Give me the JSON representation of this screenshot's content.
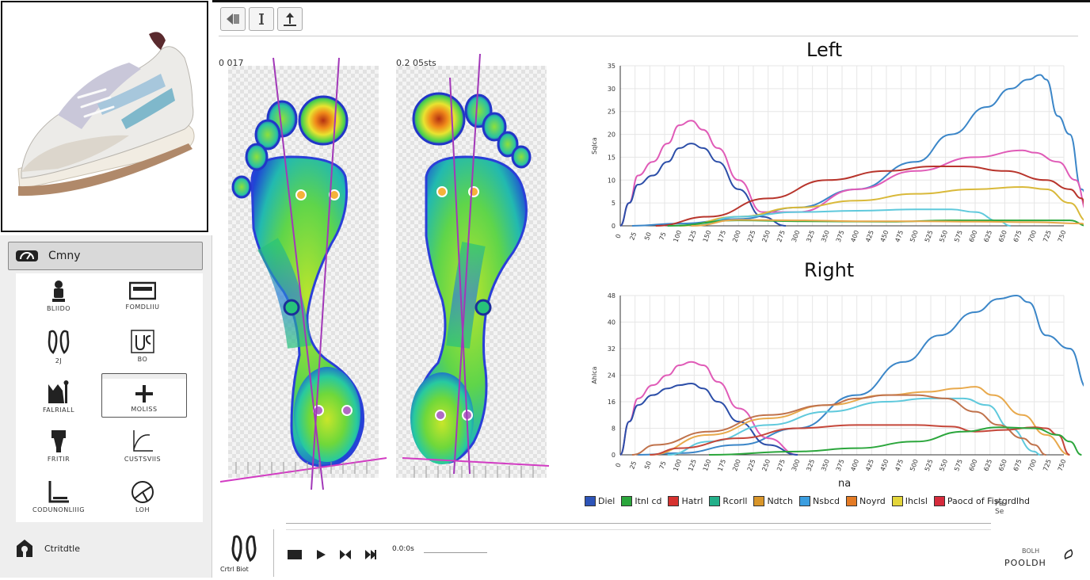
{
  "sidebar": {
    "category_label": "Cmny",
    "tools": [
      {
        "label": "BLIIDO",
        "icon": "person-icon"
      },
      {
        "label": "FOMDLIIU",
        "icon": "platform-icon"
      },
      {
        "label": "2J",
        "icon": "footprints-icon"
      },
      {
        "label": "BO",
        "icon": "foot-outline-icon"
      },
      {
        "label": "FALRIALL",
        "icon": "posture-icon"
      },
      {
        "label": "MOLISS",
        "icon": "plus-icon"
      },
      {
        "label": "FRITIR",
        "icon": "leg-icon"
      },
      {
        "label": "CUSTSVIIS",
        "icon": "curve-icon"
      },
      {
        "label": "CODUNONLIIIG",
        "icon": "angle-icon"
      },
      {
        "label": "LOH",
        "icon": "compass-icon"
      }
    ],
    "footer_label": "Ctritdtle"
  },
  "toolbar": {
    "buttons": [
      "back-icon",
      "info-icon",
      "upload-icon"
    ]
  },
  "footprints": {
    "left_label": "0 017",
    "right_label": "0.2 05sts"
  },
  "charts": {
    "left_title": "Left",
    "right_title": "Right",
    "left_ylabel": "Sqlca",
    "right_ylabel": "Ahlca",
    "xunit": "na"
  },
  "legend": [
    {
      "label": "Diel",
      "color": "#2d54b8"
    },
    {
      "label": "Itnl cd",
      "color": "#2ba63c"
    },
    {
      "label": "Hatrl",
      "color": "#d6322f"
    },
    {
      "label": "Rcorll",
      "color": "#23b08a"
    },
    {
      "label": "Ndtch",
      "color": "#d9962a"
    },
    {
      "label": "Nsbcd",
      "color": "#3b9ee0"
    },
    {
      "label": "Noyrd",
      "color": "#e47b25"
    },
    {
      "label": "Ihclsl",
      "color": "#e3d53a"
    },
    {
      "label": "Paocd of Fistgrdlhd",
      "color": "#d62b3c"
    }
  ],
  "side_note": "Pa Se",
  "player": {
    "gait_label": "Crtrl Biot",
    "time_label": "0.0:0s",
    "status_label": "POOLDH",
    "status_small": "BOLH"
  },
  "chart_data": [
    {
      "type": "line",
      "title": "Left",
      "xlabel": "",
      "ylabel": "Sqlca",
      "x_tick_labels": [
        "0",
        "25",
        "50",
        "75",
        "100",
        "125",
        "150",
        "175",
        "200",
        "225",
        "250",
        "275",
        "300",
        "325",
        "350",
        "375",
        "400",
        "425",
        "450",
        "475",
        "500",
        "525",
        "550",
        "575",
        "600",
        "625",
        "650",
        "675",
        "700",
        "725",
        "750"
      ],
      "y_tick_labels": [
        "0",
        "5",
        "10",
        "15",
        "20",
        "25",
        "30",
        "35"
      ],
      "ylim": [
        0,
        35
      ],
      "xlim": [
        0,
        750
      ],
      "series": [
        {
          "color": "#3b86c8",
          "points": [
            [
              20,
              0
            ],
            [
              100,
              0.5
            ],
            [
              200,
              1.5
            ],
            [
              300,
              4
            ],
            [
              400,
              8
            ],
            [
              500,
              14
            ],
            [
              560,
              20
            ],
            [
              620,
              26
            ],
            [
              660,
              30
            ],
            [
              690,
              32
            ],
            [
              710,
              33
            ],
            [
              720,
              32
            ],
            [
              740,
              24
            ],
            [
              760,
              20
            ],
            [
              780,
              8
            ],
            [
              800,
              1
            ],
            [
              820,
              0
            ]
          ]
        },
        {
          "color": "#e05bb7",
          "points": [
            [
              0,
              0
            ],
            [
              15,
              5
            ],
            [
              30,
              11
            ],
            [
              55,
              14
            ],
            [
              80,
              18
            ],
            [
              100,
              22
            ],
            [
              120,
              23
            ],
            [
              140,
              21
            ],
            [
              165,
              17
            ],
            [
              200,
              10
            ],
            [
              240,
              3
            ],
            [
              300,
              3
            ],
            [
              400,
              8
            ],
            [
              500,
              12
            ],
            [
              600,
              15
            ],
            [
              680,
              16.5
            ],
            [
              700,
              16
            ],
            [
              740,
              14
            ],
            [
              770,
              10
            ],
            [
              790,
              3
            ],
            [
              800,
              0
            ]
          ]
        },
        {
          "color": "#2c4ea8",
          "points": [
            [
              0,
              0
            ],
            [
              15,
              5
            ],
            [
              30,
              9
            ],
            [
              55,
              11
            ],
            [
              80,
              14
            ],
            [
              100,
              17
            ],
            [
              120,
              18
            ],
            [
              140,
              17
            ],
            [
              165,
              14
            ],
            [
              200,
              8
            ],
            [
              240,
              2
            ],
            [
              280,
              0
            ]
          ]
        },
        {
          "color": "#b8352c",
          "points": [
            [
              60,
              0
            ],
            [
              150,
              2
            ],
            [
              250,
              6
            ],
            [
              350,
              10
            ],
            [
              450,
              12
            ],
            [
              530,
              13
            ],
            [
              580,
              13
            ],
            [
              650,
              12
            ],
            [
              720,
              10
            ],
            [
              760,
              8
            ],
            [
              780,
              6
            ],
            [
              790,
              3
            ],
            [
              800,
              0
            ]
          ]
        },
        {
          "color": "#d9b93a",
          "points": [
            [
              100,
              0
            ],
            [
              200,
              2
            ],
            [
              300,
              4
            ],
            [
              400,
              5.5
            ],
            [
              500,
              7
            ],
            [
              600,
              8
            ],
            [
              680,
              8.5
            ],
            [
              720,
              8
            ],
            [
              760,
              5
            ],
            [
              790,
              1
            ],
            [
              800,
              0
            ]
          ]
        },
        {
          "color": "#5fc9dc",
          "points": [
            [
              120,
              0
            ],
            [
              200,
              2
            ],
            [
              300,
              3
            ],
            [
              400,
              3.3
            ],
            [
              500,
              3.6
            ],
            [
              560,
              3.6
            ],
            [
              600,
              3
            ],
            [
              640,
              1
            ],
            [
              660,
              0
            ]
          ]
        },
        {
          "color": "#2ba63c",
          "points": [
            [
              80,
              0
            ],
            [
              200,
              1.2
            ],
            [
              300,
              1
            ],
            [
              450,
              0.9
            ],
            [
              560,
              1.2
            ],
            [
              650,
              1.2
            ],
            [
              760,
              1.2
            ],
            [
              790,
              0
            ]
          ]
        },
        {
          "color": "#e8a94c",
          "points": [
            [
              120,
              0
            ],
            [
              200,
              1.3
            ],
            [
              300,
              1.2
            ],
            [
              400,
              1
            ],
            [
              500,
              1
            ],
            [
              600,
              0.9
            ],
            [
              700,
              0.8
            ],
            [
              780,
              0.5
            ],
            [
              790,
              0
            ]
          ]
        }
      ]
    },
    {
      "type": "line",
      "title": "Right",
      "xlabel": "na",
      "ylabel": "Ahlca",
      "x_tick_labels": [
        "0",
        "25",
        "50",
        "75",
        "100",
        "125",
        "150",
        "175",
        "200",
        "225",
        "250",
        "275",
        "300",
        "325",
        "350",
        "375",
        "400",
        "425",
        "450",
        "475",
        "500",
        "525",
        "550",
        "575",
        "600",
        "625",
        "650",
        "675",
        "700",
        "725",
        "750"
      ],
      "y_tick_labels": [
        "0",
        "8",
        "16",
        "24",
        "32",
        "40",
        "48"
      ],
      "ylim": [
        0,
        48
      ],
      "xlim": [
        0,
        750
      ],
      "series": [
        {
          "color": "#3b86c8",
          "points": [
            [
              30,
              0
            ],
            [
              100,
              0.5
            ],
            [
              200,
              3
            ],
            [
              300,
              8
            ],
            [
              400,
              18
            ],
            [
              480,
              28
            ],
            [
              540,
              36
            ],
            [
              600,
              43
            ],
            [
              640,
              47
            ],
            [
              670,
              48
            ],
            [
              690,
              46
            ],
            [
              720,
              36
            ],
            [
              760,
              32
            ],
            [
              790,
              20
            ],
            [
              810,
              4
            ],
            [
              825,
              0
            ]
          ]
        },
        {
          "color": "#e05bb7",
          "points": [
            [
              0,
              0
            ],
            [
              15,
              10
            ],
            [
              30,
              17
            ],
            [
              55,
              21
            ],
            [
              80,
              24
            ],
            [
              100,
              27
            ],
            [
              120,
              28
            ],
            [
              140,
              27
            ],
            [
              165,
              22
            ],
            [
              200,
              14
            ],
            [
              250,
              5
            ],
            [
              300,
              0
            ]
          ]
        },
        {
          "color": "#2c4ea8",
          "points": [
            [
              0,
              0
            ],
            [
              15,
              10
            ],
            [
              30,
              15
            ],
            [
              55,
              18
            ],
            [
              80,
              20
            ],
            [
              100,
              21
            ],
            [
              120,
              21.5
            ],
            [
              140,
              20
            ],
            [
              165,
              16
            ],
            [
              200,
              10
            ],
            [
              250,
              3
            ],
            [
              300,
              0
            ]
          ]
        },
        {
          "color": "#e8a94c",
          "points": [
            [
              50,
              0
            ],
            [
              150,
              6
            ],
            [
              250,
              11
            ],
            [
              350,
              15
            ],
            [
              450,
              18
            ],
            [
              520,
              19
            ],
            [
              570,
              20
            ],
            [
              600,
              20.5
            ],
            [
              630,
              18
            ],
            [
              680,
              12
            ],
            [
              720,
              6
            ],
            [
              760,
              0
            ]
          ]
        },
        {
          "color": "#5fc9dc",
          "points": [
            [
              80,
              0
            ],
            [
              150,
              4
            ],
            [
              250,
              9
            ],
            [
              350,
              13
            ],
            [
              450,
              16
            ],
            [
              520,
              17
            ],
            [
              580,
              17
            ],
            [
              620,
              15
            ],
            [
              660,
              8
            ],
            [
              700,
              1
            ],
            [
              710,
              0
            ]
          ]
        },
        {
          "color": "#c0724b",
          "points": [
            [
              20,
              0
            ],
            [
              60,
              3
            ],
            [
              150,
              7
            ],
            [
              250,
              12
            ],
            [
              350,
              15
            ],
            [
              400,
              17
            ],
            [
              450,
              18
            ],
            [
              500,
              18
            ],
            [
              550,
              17
            ],
            [
              600,
              13
            ],
            [
              640,
              9
            ],
            [
              680,
              5
            ],
            [
              700,
              3
            ],
            [
              720,
              0
            ]
          ]
        },
        {
          "color": "#c5473a",
          "points": [
            [
              50,
              0
            ],
            [
              100,
              2
            ],
            [
              200,
              5
            ],
            [
              300,
              8
            ],
            [
              400,
              9
            ],
            [
              500,
              9
            ],
            [
              560,
              8.5
            ],
            [
              600,
              7
            ],
            [
              650,
              7.5
            ],
            [
              700,
              8.3
            ],
            [
              720,
              8
            ],
            [
              740,
              6
            ],
            [
              760,
              0
            ]
          ]
        },
        {
          "color": "#2ba63c",
          "points": [
            [
              150,
              0
            ],
            [
              300,
              1
            ],
            [
              400,
              2
            ],
            [
              500,
              4
            ],
            [
              580,
              7
            ],
            [
              640,
              8.3
            ],
            [
              700,
              8
            ],
            [
              740,
              6
            ],
            [
              760,
              4
            ],
            [
              780,
              0
            ]
          ]
        }
      ]
    }
  ]
}
